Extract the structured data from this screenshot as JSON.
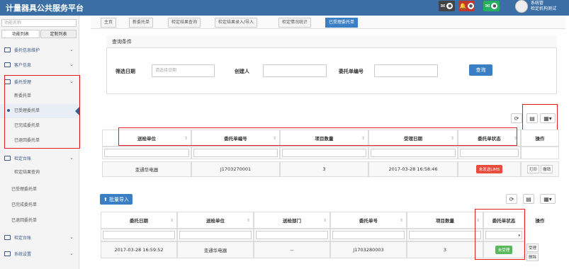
{
  "app": {
    "title": "计量器具公共服务平台",
    "user_line1": "系统管",
    "user_line2": "检定机构测试"
  },
  "header_buttons": [
    {
      "color": "#444"
    },
    {
      "color": "#c0392b"
    },
    {
      "color": "#27ae60"
    }
  ],
  "sidebar": {
    "search_placeholder": "功能名称",
    "tabs": [
      "功能列表",
      "定制列表"
    ],
    "groups": [
      {
        "label": "委托信息维护"
      },
      {
        "label": "客户信息"
      },
      {
        "label": "委托受理"
      }
    ],
    "sub_delegation": [
      "新委托单",
      "已受理委托单",
      "已完成委托单",
      "已退回委托单"
    ],
    "group_check": "检定台账",
    "sub_check": [
      "检定结果查询",
      "已受理委托单",
      "已完成委托单",
      "已退回委托单"
    ],
    "group_certify": "检定台账",
    "group_system": "系统设置"
  },
  "tabs": [
    {
      "label": "主页"
    },
    {
      "label": "新委托单"
    },
    {
      "label": "检定结果查询"
    },
    {
      "label": "检定结果录入/导入"
    },
    {
      "label": "检定情况统计"
    },
    {
      "label": "已受理委托单"
    }
  ],
  "query": {
    "title": "查询条件",
    "date_label": "筛选日期",
    "date_placeholder": "请选择日期",
    "creator_label": "创建人",
    "orderno_label": "委托单编号",
    "search_btn": "查询"
  },
  "table1": {
    "headers": [
      "送检单位",
      "委托单编号",
      "项目数量",
      "受理日期",
      "委托单状态",
      "操作"
    ],
    "row": {
      "unit": "变通华电器",
      "no": "J1703270001",
      "count": "3",
      "date": "2017-03-28 16:58:46",
      "status": "未发送LIMS",
      "btn1": "打印",
      "btn2": "撤销"
    },
    "status_color": "#e74c3c"
  },
  "batch_import_btn": "批量导入",
  "table2": {
    "headers": [
      "委托日期",
      "送检单位",
      "送检部门",
      "委托单号",
      "项目数量",
      "委托单状态",
      "操作"
    ],
    "row": {
      "date": "2017-03-28 16:59:52",
      "unit": "变通华电器",
      "dept": "--",
      "no": "J1703280003",
      "count": "3",
      "status": "未受理",
      "btn1": "受理",
      "btn2": "删除"
    },
    "status_color": "#5cb85c"
  }
}
